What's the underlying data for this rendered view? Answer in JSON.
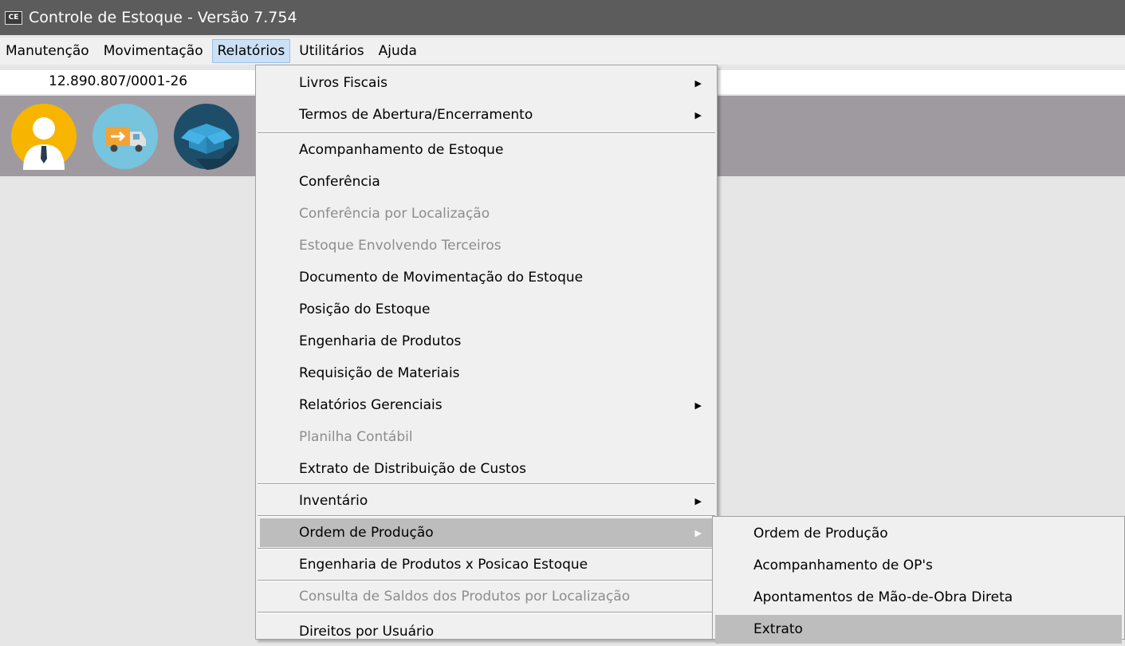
{
  "window": {
    "icon_text": "CE",
    "title": "Controle de Estoque - Versão 7.754"
  },
  "menubar": {
    "items": [
      "Manutenção",
      "Movimentação",
      "Relatórios",
      "Utilitários",
      "Ajuda"
    ]
  },
  "infobar": {
    "cnpj": "12.890.807/0001-26"
  },
  "toolbar": {
    "icons": [
      "user-icon",
      "delivery-truck-icon",
      "box-icon"
    ]
  },
  "relatorios_menu": {
    "items": [
      "Livros Fiscais",
      "Termos de Abertura/Encerramento",
      "Acompanhamento de Estoque",
      "Conferência",
      "Conferência por Localização",
      "Estoque Envolvendo Terceiros",
      "Documento de Movimentação do Estoque",
      "Posição do Estoque",
      "Engenharia de Produtos",
      "Requisição de Materiais",
      "Relatórios Gerenciais",
      "Planilha Contábil",
      "Extrato de Distribuição de Custos",
      "Inventário",
      "Ordem de Produção",
      "Engenharia de Produtos x Posicao Estoque",
      "Consulta de Saldos dos Produtos por Localização",
      "Direitos por Usuário"
    ]
  },
  "ordem_producao_submenu": {
    "items": [
      "Ordem de Produção",
      "Acompanhamento de OP's",
      "Apontamentos de Mão-de-Obra Direta",
      "Extrato"
    ]
  },
  "colors": {
    "title_bar": "#5c5c5c",
    "toolbar_bg": "#9e9aa0",
    "highlight": "#bdbdbd",
    "disabled_text": "#8d8d8d"
  }
}
